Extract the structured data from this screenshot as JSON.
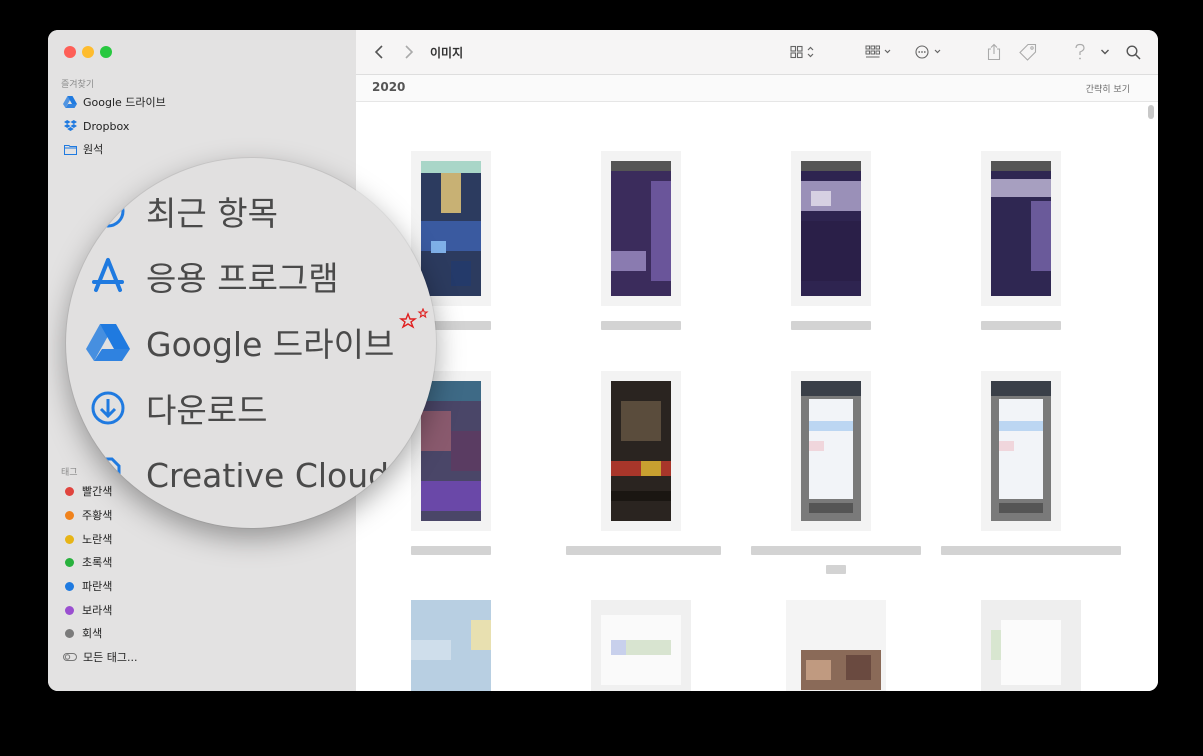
{
  "window": {
    "title": "이미지",
    "group_title": "2020",
    "group_action": "간략히 보기"
  },
  "sidebar": {
    "favorites_title": "즐겨찾기",
    "favorites": [
      {
        "label": "Google 드라이브",
        "icon": "google-drive-icon"
      },
      {
        "label": "Dropbox",
        "icon": "dropbox-icon"
      },
      {
        "label": "원석",
        "icon": "folder-icon"
      }
    ],
    "tags_title": "태그",
    "tags": [
      {
        "label": "빨간색",
        "color": "#e0443e"
      },
      {
        "label": "주황색",
        "color": "#f0821c"
      },
      {
        "label": "노란색",
        "color": "#e7b416"
      },
      {
        "label": "초록색",
        "color": "#28b13d"
      },
      {
        "label": "파란색",
        "color": "#1f7ae0"
      },
      {
        "label": "보라색",
        "color": "#9a4fd0"
      },
      {
        "label": "회색",
        "color": "#7b7b7b"
      }
    ],
    "all_tags_label": "모든 태그..."
  },
  "magnifier": {
    "items": [
      {
        "label": "최근 항목",
        "icon": "recents-icon"
      },
      {
        "label": "응용 프로그램",
        "icon": "applications-icon"
      },
      {
        "label": "Google 드라이브",
        "icon": "google-drive-icon"
      },
      {
        "label": "다운로드",
        "icon": "downloads-icon"
      },
      {
        "label": "Creative Cloud Fil",
        "icon": "document-icon"
      }
    ],
    "highlight_icon": "sparkle-stars-icon"
  },
  "toolbar": {
    "icons": [
      "back-icon",
      "forward-icon",
      "icon-view-icon",
      "group-icon",
      "more-actions-icon",
      "share-icon",
      "tag-icon",
      "help-icon",
      "chevron-down-icon",
      "search-icon"
    ]
  },
  "grid": {
    "rows": 3,
    "columns": 4
  }
}
